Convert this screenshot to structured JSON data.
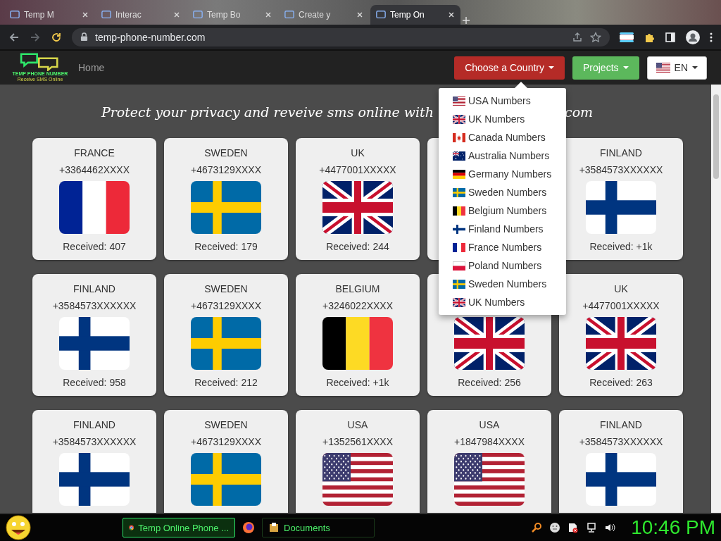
{
  "browser": {
    "tabs": [
      {
        "title": "Temp M",
        "selected": false
      },
      {
        "title": "Interac",
        "selected": false
      },
      {
        "title": "Temp Bo",
        "selected": false
      },
      {
        "title": "Create y",
        "selected": false
      },
      {
        "title": "Temp On",
        "selected": true
      }
    ],
    "url": "temp-phone-number.com"
  },
  "nav": {
    "logo": {
      "title": "TEMP PHONE NUMBER",
      "subtitle": "Receive SMS Online"
    },
    "home": "Home",
    "country_button": "Choose a Country",
    "projects_button": "Projects",
    "language_button": {
      "kind": "us",
      "label": "EN"
    }
  },
  "headline": {
    "left": "Protect your privacy and reveive sms online with",
    "right": "com"
  },
  "cards": [
    {
      "country": "FRANCE",
      "number": "+3364462XXXX",
      "kind": "fr",
      "received": "Received: 407"
    },
    {
      "country": "SWEDEN",
      "number": "+4673129XXXX",
      "kind": "se",
      "received": "Received: 179"
    },
    {
      "country": "UK",
      "number": "+4477001XXXXX",
      "kind": "uk",
      "received": "Received: 244"
    },
    {
      "kind": "covered"
    },
    {
      "country": "FINLAND",
      "number": "+3584573XXXXXX",
      "kind": "fi",
      "received": "Received: +1k"
    },
    {
      "country": "FINLAND",
      "number": "+3584573XXXXXX",
      "kind": "fi",
      "received": "Received: 958"
    },
    {
      "country": "SWEDEN",
      "number": "+4673129XXXX",
      "kind": "se",
      "received": "Received: 212"
    },
    {
      "country": "BELGIUM",
      "number": "+3246022XXXX",
      "kind": "be",
      "received": "Received: +1k"
    },
    {
      "kind": "uk",
      "received": "Received: 256"
    },
    {
      "country": "UK",
      "number": "+4477001XXXXX",
      "kind": "uk",
      "received": "Received: 263"
    },
    {
      "country": "FINLAND",
      "number": "+3584573XXXXXX",
      "kind": "fi"
    },
    {
      "country": "SWEDEN",
      "number": "+4673129XXXX",
      "kind": "se"
    },
    {
      "country": "USA",
      "number": "+1352561XXXX",
      "kind": "us"
    },
    {
      "country": "USA",
      "number": "+1847984XXXX",
      "kind": "us"
    },
    {
      "country": "FINLAND",
      "number": "+3584573XXXXXX",
      "kind": "fi"
    }
  ],
  "country_menu": [
    {
      "kind": "us",
      "label": "USA Numbers"
    },
    {
      "kind": "uk",
      "label": "UK Numbers"
    },
    {
      "kind": "ca",
      "label": "Canada Numbers"
    },
    {
      "kind": "au",
      "label": "Australia Numbers"
    },
    {
      "kind": "de",
      "label": "Germany Numbers"
    },
    {
      "kind": "se",
      "label": "Sweden Numbers"
    },
    {
      "kind": "be",
      "label": "Belgium Numbers"
    },
    {
      "kind": "fi",
      "label": "Finland Numbers"
    },
    {
      "kind": "fr",
      "label": "France Numbers"
    },
    {
      "kind": "pl",
      "label": "Poland Numbers"
    },
    {
      "kind": "se",
      "label": "Sweden Numbers"
    },
    {
      "kind": "uk",
      "label": "UK Numbers"
    }
  ],
  "taskbar": {
    "tasks": [
      {
        "kind": "chrome",
        "label": "Temp Online Phone ...",
        "selected": true
      },
      {
        "kind": "firefox"
      },
      {
        "kind": "folder",
        "label": "Documents",
        "selected": false
      }
    ],
    "clock": "10:46 PM"
  }
}
